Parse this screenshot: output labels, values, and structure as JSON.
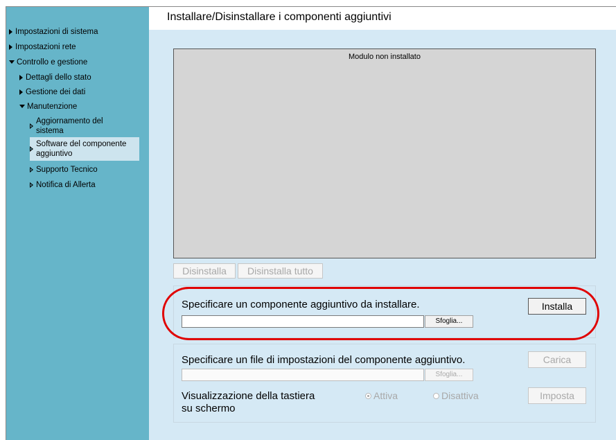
{
  "page_title": "Installare/Disinstallare i componenti aggiuntivi",
  "sidebar": {
    "items": [
      {
        "label": "Impostazioni di sistema"
      },
      {
        "label": "Impostazioni rete"
      },
      {
        "label": "Controllo e gestione"
      },
      {
        "label": "Dettagli dello stato"
      },
      {
        "label": "Gestione dei dati"
      },
      {
        "label": "Manutenzione"
      },
      {
        "label_line1": "Aggiornamento del",
        "label_line2": "sistema"
      },
      {
        "label_line1": "Software del componente",
        "label_line2": "aggiuntivo",
        "selected": true
      },
      {
        "label": "Supporto Tecnico"
      },
      {
        "label": "Notifica di Allerta"
      }
    ]
  },
  "module_box": {
    "status": "Modulo non installato"
  },
  "actions": {
    "uninstall": "Disinstalla",
    "uninstall_all": "Disinstalla tutto"
  },
  "install_panel": {
    "label": "Specificare un componente aggiuntivo da installare.",
    "file_value": "",
    "browse": "Sfoglia...",
    "install": "Installa"
  },
  "settings_panel": {
    "label": "Specificare un file di impostazioni del componente aggiuntivo.",
    "file_value": "",
    "browse": "Sfoglia...",
    "load": "Carica",
    "keyboard_label_line1": "Visualizzazione della tastiera",
    "keyboard_label_line2": "su schermo",
    "option_on": "Attiva",
    "option_off": "Disattiva",
    "option_selected": "Attiva",
    "set": "Imposta"
  },
  "colors": {
    "sidebar_bg": "#66b5c9",
    "content_bg": "#d5e9f5",
    "highlight": "#e00000"
  },
  "icons": {
    "collapsed": "triangle-right-icon",
    "expanded": "triangle-down-icon",
    "leaf": "triangle-right-outline-icon"
  }
}
